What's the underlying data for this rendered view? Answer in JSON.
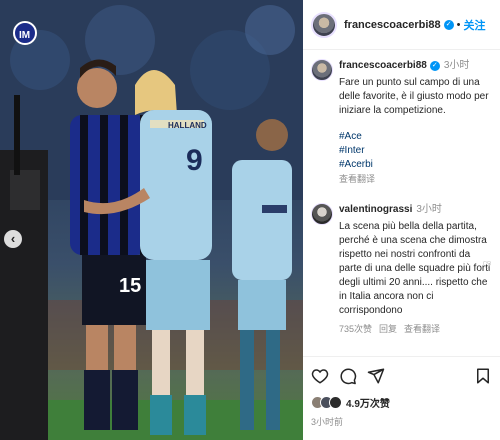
{
  "post": {
    "header": {
      "username": "francescoacerbi88",
      "verified_badge": "✓",
      "separator": "•",
      "follow_label": "关注"
    },
    "caption": {
      "username": "francescoacerbi88",
      "time": "3小时",
      "text": "Fare un punto sul campo di una delle favorite, è il giusto modo per iniziare la competizione.",
      "hashtags": [
        "#Ace",
        "#Inter",
        "#Acerbi"
      ],
      "translate_label": "查看翻译"
    },
    "comments": [
      {
        "username": "valentinograssi",
        "time": "3小时",
        "text": "La scena più bella della partita, perché è una scena che dimostra rispetto nei nostri confronti da parte di una delle squadre più forti degli ultimi 20 anni.... rispetto che in Italia ancora non ci corrispondono",
        "likes": "735次赞",
        "reply_label": "回复",
        "translate_label": "查看翻译"
      }
    ],
    "likes_text": "4.9万次赞",
    "post_time": "3小时前"
  },
  "photo": {
    "left_player_number": "15",
    "right_player_back_number": "9",
    "right_player_name": "HALLAND"
  },
  "colors": {
    "accent_blue": "#0095f6",
    "hashtag_blue": "#00376b",
    "muted": "#8e8e8e",
    "inter_blue": "#1b2c8a",
    "city_kit": "#a9d2e8"
  },
  "icons": [
    "inter-logo-icon",
    "chevron-left-icon",
    "verified-icon",
    "heart-icon",
    "comment-icon",
    "share-icon",
    "bookmark-icon"
  ]
}
